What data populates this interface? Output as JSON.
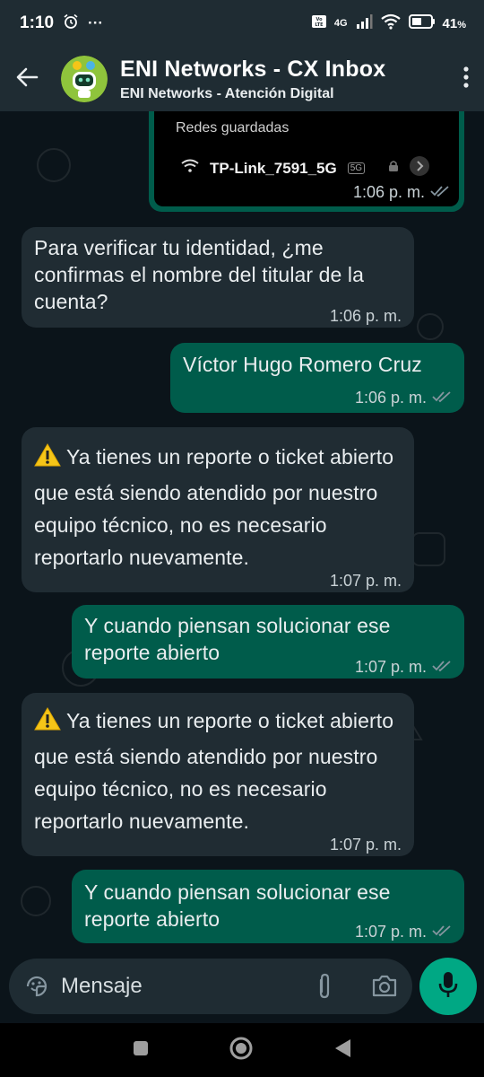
{
  "status_bar": {
    "time": "1:10",
    "more": "···",
    "battery": "41",
    "battery_unit": "%",
    "network": "4G"
  },
  "header": {
    "title": "ENI Networks - CX Inbox",
    "subtitle": "ENI Networks - Atención Digital"
  },
  "image_message": {
    "section_label": "Redes guardadas",
    "network_name": "TP-Link_7591_5G",
    "band_badge": "5G",
    "time": "1:06 p. m."
  },
  "messages": [
    {
      "direction": "in",
      "text": "Para verificar tu identidad, ¿me confirmas el nombre del titular de la cuenta?",
      "time": "1:06 p. m."
    },
    {
      "direction": "out",
      "text": "Víctor Hugo Romero Cruz",
      "time": "1:06 p. m."
    },
    {
      "direction": "in",
      "text": "Ya tienes un reporte o ticket abierto que está siendo atendido por nuestro equipo técnico, no es necesario reportarlo nuevamente.",
      "time": "1:07 p. m."
    },
    {
      "direction": "out",
      "text": "Y cuando piensan solucionar ese reporte abierto",
      "time": "1:07 p. m."
    },
    {
      "direction": "in",
      "text": "Ya tienes un reporte o ticket abierto que está siendo atendido por nuestro equipo técnico, no es necesario reportarlo nuevamente.",
      "time": "1:07 p. m."
    },
    {
      "direction": "out",
      "text": "Y cuando piensan solucionar ese reporte abierto",
      "time": "1:07 p. m."
    }
  ],
  "composer": {
    "placeholder": "Mensaje"
  },
  "colors": {
    "incoming_bubble": "#202c33",
    "outgoing_bubble": "#005c4b",
    "accent": "#00a884",
    "read_ticks": "#8696a0"
  },
  "icons": [
    "back-arrow-icon",
    "more-vertical-icon",
    "sticker-icon",
    "attach-icon",
    "camera-icon",
    "mic-icon",
    "warning-icon",
    "double-check-icon",
    "wifi-icon",
    "lock-icon",
    "chevron-right-icon"
  ]
}
